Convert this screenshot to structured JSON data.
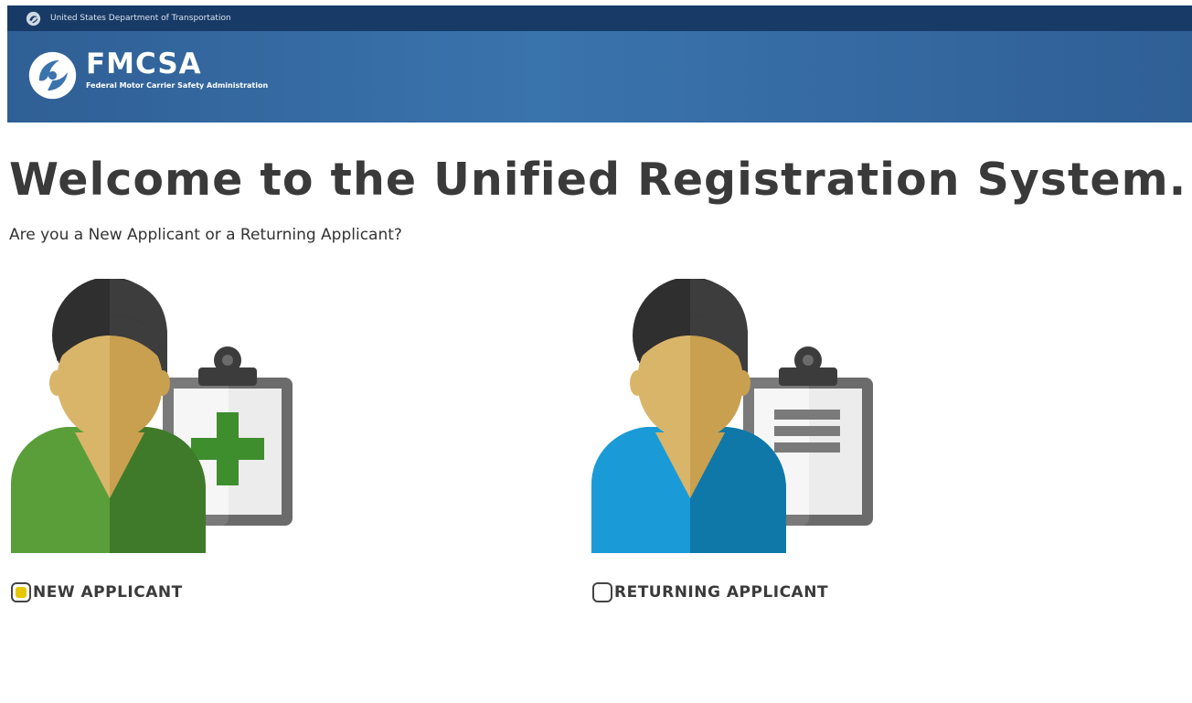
{
  "header": {
    "department_text": "United States Department of Transportation",
    "title": "FMCSA",
    "subtitle": "Federal Motor Carrier Safety Administration"
  },
  "main": {
    "heading": "Welcome to the Unified Registration System.",
    "question": "Are you a New Applicant or a Returning Applicant?",
    "options": [
      {
        "label": "NEW APPLICANT",
        "selected": true,
        "icon": "new-applicant-icon",
        "shirt_color": "#5a9e3a"
      },
      {
        "label": "RETURNING APPLICANT",
        "selected": false,
        "icon": "returning-applicant-icon",
        "shirt_color": "#1a9bd7"
      }
    ]
  },
  "colors": {
    "header_top": "#183a66",
    "header_main": "#3a74ad",
    "selected_checkbox": "#e6c800",
    "text_dark": "#3a3a3a"
  }
}
